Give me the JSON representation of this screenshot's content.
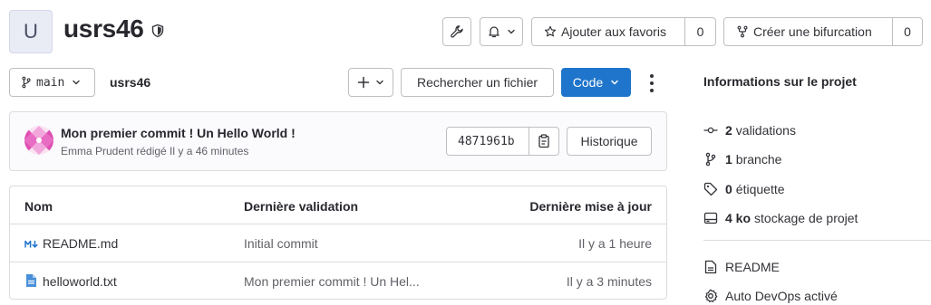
{
  "project": {
    "avatar_letter": "U",
    "name": "usrs46"
  },
  "header": {
    "favorite_label": "Ajouter aux favoris",
    "favorite_count": "0",
    "fork_label": "Créer une bifurcation",
    "fork_count": "0"
  },
  "toolbar": {
    "branch": "main",
    "breadcrumb": "usrs46",
    "add_icon": "plus-icon",
    "find_file_label": "Rechercher un fichier",
    "code_label": "Code"
  },
  "commit": {
    "title": "Mon premier commit ! Un Hello World !",
    "meta": "Emma Prudent rédigé Il y a 46 minutes",
    "sha": "4871961b",
    "history_label": "Historique"
  },
  "files": {
    "headers": {
      "name": "Nom",
      "last_commit": "Dernière validation",
      "last_update": "Dernière mise à jour"
    },
    "rows": [
      {
        "name": "README.md",
        "icon": "markdown-icon",
        "commit": "Initial commit",
        "updated": "Il y a 1 heure"
      },
      {
        "name": "helloworld.txt",
        "icon": "text-file-icon",
        "commit": "Mon premier commit ! Un Hel...",
        "updated": "Il y a 3 minutes"
      }
    ]
  },
  "sidebar": {
    "title": "Informations sur le projet",
    "stats": [
      {
        "value": "2",
        "label": "validations",
        "icon": "commit-icon"
      },
      {
        "value": "1",
        "label": "branche",
        "icon": "branch-icon"
      },
      {
        "value": "0",
        "label": "étiquette",
        "icon": "tag-icon"
      },
      {
        "value": "4 ko",
        "label": "stockage de projet",
        "icon": "storage-icon"
      }
    ],
    "links": [
      {
        "label": "README",
        "icon": "readme-icon"
      },
      {
        "label": "Auto DevOps activé",
        "icon": "settings-icon"
      }
    ]
  },
  "colors": {
    "primary": "#1f75cb",
    "border": "#dcdcde",
    "text": "#333238",
    "muted": "#626168"
  }
}
